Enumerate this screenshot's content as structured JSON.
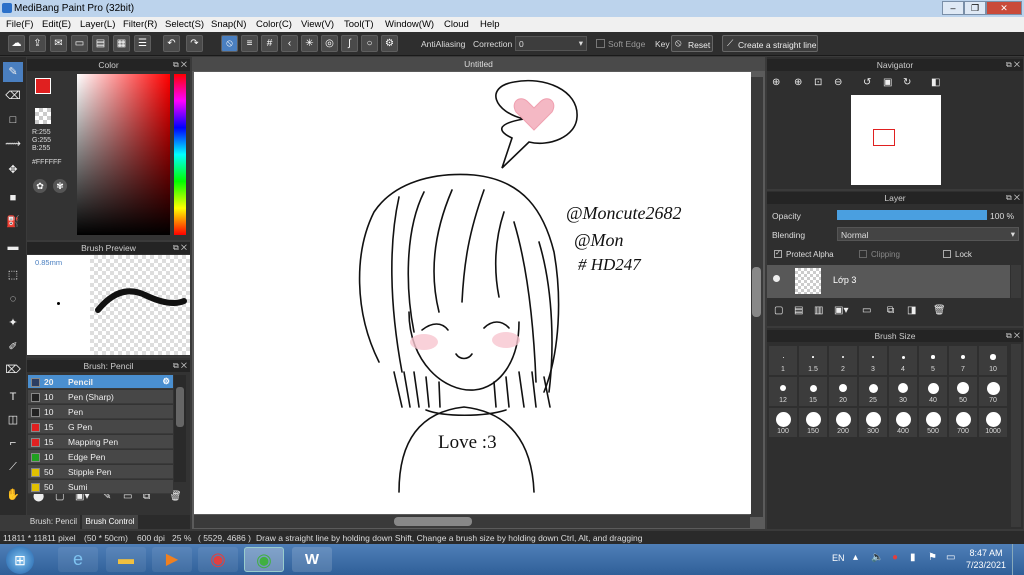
{
  "window": {
    "title": "MediBang Paint Pro (32bit)",
    "minimize": "–",
    "restore": "❐",
    "close": "✕"
  },
  "menu": [
    "File(F)",
    "Edit(E)",
    "Layer(L)",
    "Filter(R)",
    "Select(S)",
    "Snap(N)",
    "Color(C)",
    "View(V)",
    "Tool(T)",
    "Window(W)",
    "Cloud",
    "Help"
  ],
  "toolbar": {
    "antialiasing": "AntiAliasing",
    "correction_label": "Correction",
    "correction_value": "0",
    "soft_edge": "Soft Edge",
    "key": "Key",
    "reset": "Reset",
    "straight_line": "Create a straight line"
  },
  "color_panel": {
    "title": "Color",
    "r": "R:255",
    "g": "G:255",
    "b": "B:255",
    "hex": "#FFFFFF"
  },
  "brush_preview": {
    "title": "Brush Preview",
    "size": "0.85mm"
  },
  "brush_panel": {
    "title": "Brush: Pencil",
    "items": [
      {
        "size": "20",
        "name": "Pencil",
        "color": "#2c3e63",
        "selected": true
      },
      {
        "size": "10",
        "name": "Pen (Sharp)",
        "color": "#222222",
        "selected": false
      },
      {
        "size": "10",
        "name": "Pen",
        "color": "#222222",
        "selected": false
      },
      {
        "size": "15",
        "name": "G Pen",
        "color": "#e02020",
        "selected": false
      },
      {
        "size": "15",
        "name": "Mapping Pen",
        "color": "#e02020",
        "selected": false
      },
      {
        "size": "10",
        "name": "Edge Pen",
        "color": "#20a020",
        "selected": false
      },
      {
        "size": "50",
        "name": "Stipple Pen",
        "color": "#e0c000",
        "selected": false
      },
      {
        "size": "50",
        "name": "Sumi",
        "color": "#e0c000",
        "selected": false
      }
    ],
    "tabs": [
      "Brush: Pencil",
      "Brush Control"
    ]
  },
  "document": {
    "title": "Untitled"
  },
  "artwork": {
    "handle1": "@Moncute2682",
    "handle2": "@Mon",
    "tag": "# HD247",
    "shirt_text": "Love :3"
  },
  "navigator": {
    "title": "Navigator"
  },
  "layer_panel": {
    "title": "Layer",
    "opacity_label": "Opacity",
    "opacity_value": "100 %",
    "opacity": 1.0,
    "blending_label": "Blending",
    "blending_value": "Normal",
    "protect_alpha": "Protect Alpha",
    "clipping": "Clipping",
    "lock": "Lock",
    "layer_name": "Lớp 3"
  },
  "brush_size": {
    "title": "Brush Size",
    "sizes": [
      "1",
      "1.5",
      "2",
      "3",
      "4",
      "5",
      "7",
      "10",
      "12",
      "15",
      "20",
      "25",
      "30",
      "40",
      "50",
      "70",
      "100",
      "150",
      "200",
      "300",
      "400",
      "500",
      "700",
      "1000"
    ]
  },
  "status": {
    "dims": "11811 * 11811 pixel",
    "cm": "(50 * 50cm)",
    "dpi": "600 dpi",
    "zoom": "25 %",
    "coords": "( 5529, 4686 )",
    "hint": "Draw a straight line by holding down Shift, Change a brush size by holding down Ctrl, Alt, and dragging"
  },
  "taskbar": {
    "lang": "EN",
    "time": "8:47 AM",
    "date": "7/23/2021"
  },
  "colors": {
    "accent": "#4a9fe0",
    "fg_color": "#e02020"
  }
}
